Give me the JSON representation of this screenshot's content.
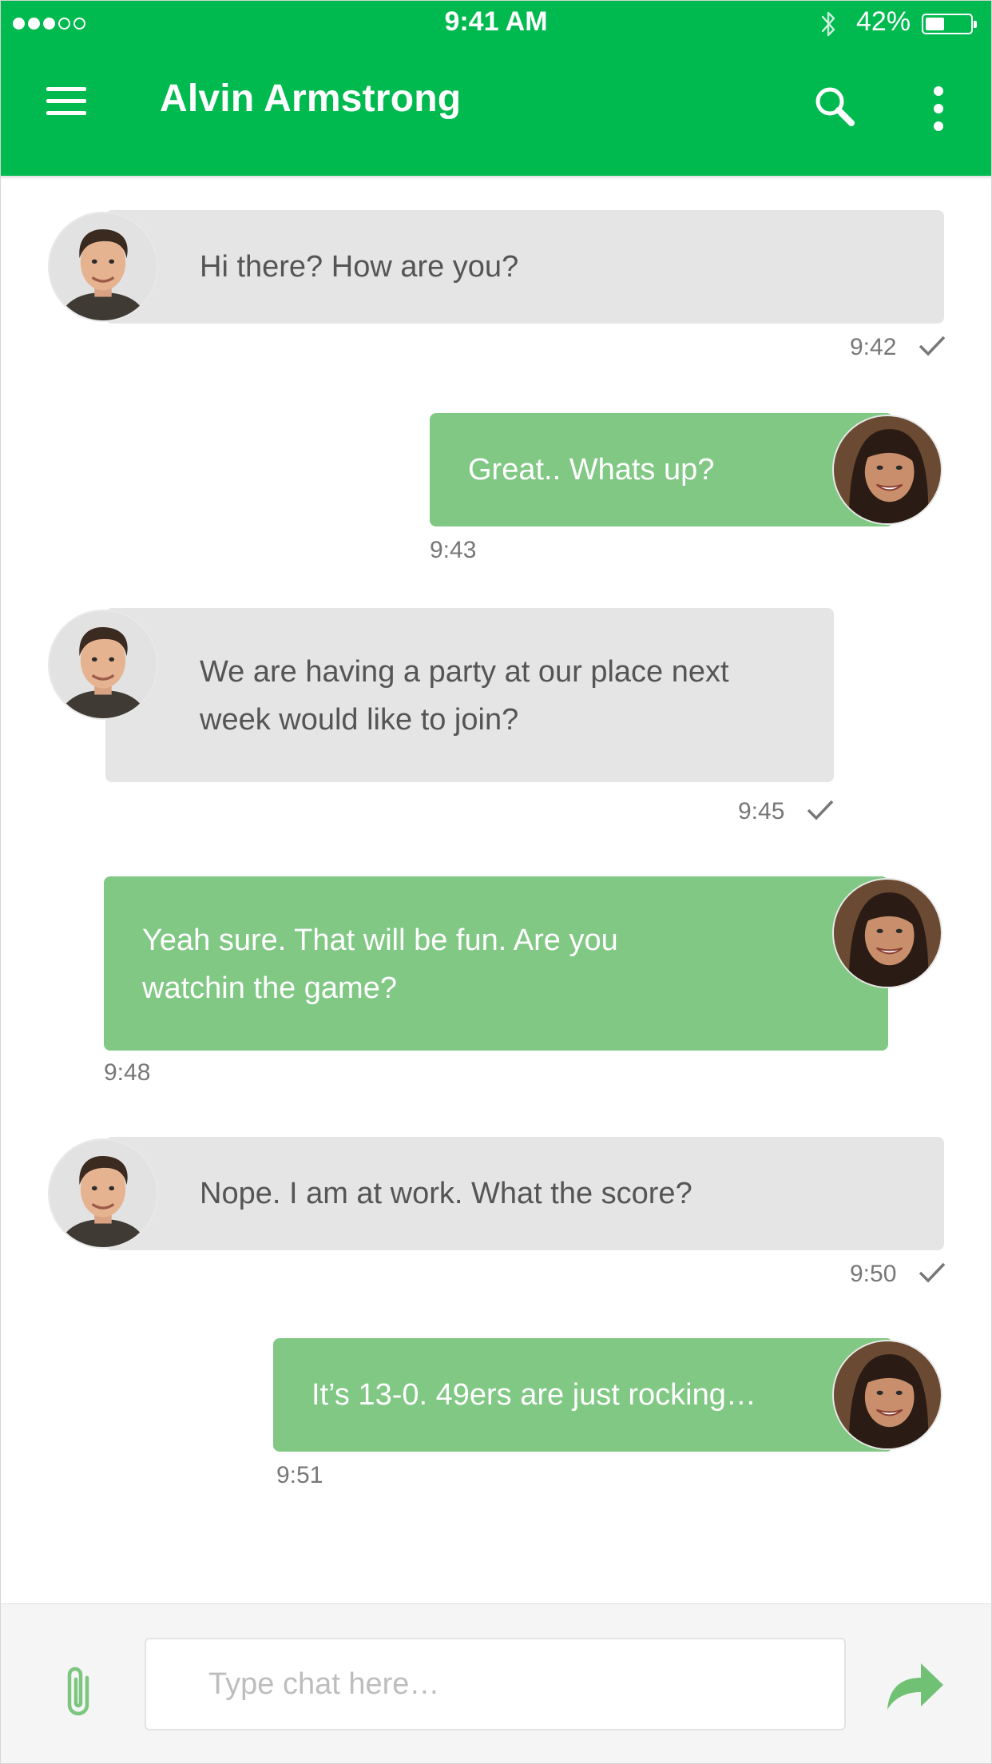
{
  "status_bar": {
    "time": "9:41 AM",
    "battery_percent": "42%",
    "battery_level": 0.42,
    "signal_bars_filled": 3,
    "signal_bars_total": 5
  },
  "header": {
    "title": "Alvin Armstrong",
    "menu_icon": "hamburger-menu-icon",
    "search_icon": "search-icon",
    "more_icon": "more-vertical-icon"
  },
  "messages": [
    {
      "direction": "incoming",
      "text": "Hi there? How are you?",
      "time": "9:42",
      "read": true
    },
    {
      "direction": "outgoing",
      "text": "Great.. Whats up?",
      "time": "9:43"
    },
    {
      "direction": "incoming",
      "text": "We are having a party at our place next week would like to join?",
      "time": "9:45",
      "read": true
    },
    {
      "direction": "outgoing",
      "text": "Yeah sure. That will be fun. Are you watchin the game?",
      "time": "9:48"
    },
    {
      "direction": "incoming",
      "text": "Nope. I am at work. What the score?",
      "time": "9:50",
      "read": true
    },
    {
      "direction": "outgoing",
      "text": "It’s 13-0. 49ers are just rocking…",
      "time": "9:51"
    }
  ],
  "composer": {
    "placeholder": "Type chat here…",
    "value": "",
    "attach_icon": "paperclip-icon",
    "send_icon": "send-arrow-icon"
  },
  "colors": {
    "brand_green": "#00ba4f",
    "outgoing_bubble": "#80c884",
    "incoming_bubble": "#e5e5e5",
    "incoming_text": "#555555",
    "timestamp": "#777777"
  }
}
